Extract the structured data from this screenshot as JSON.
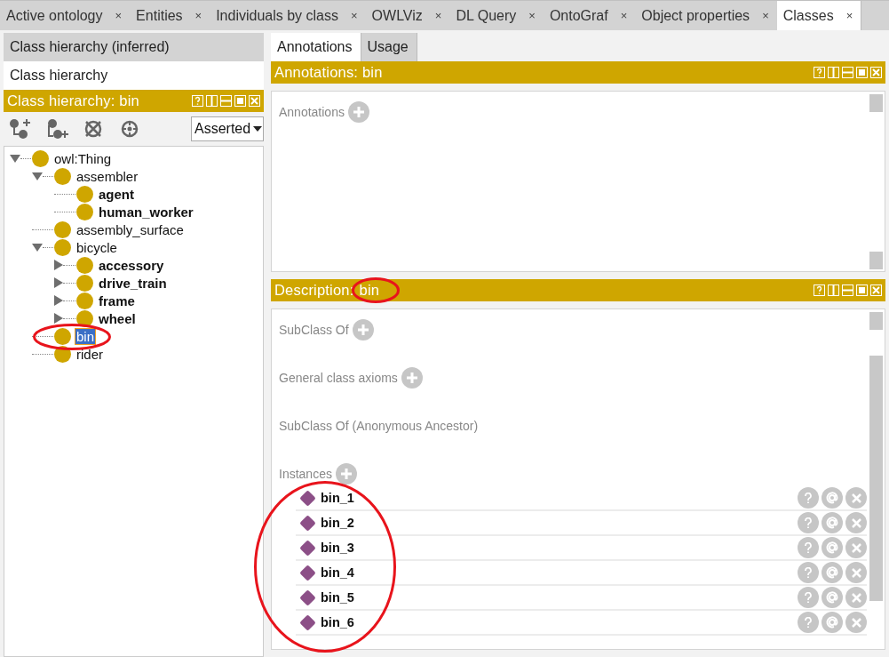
{
  "tabs": [
    {
      "label": "Active ontology",
      "close": "×",
      "selected": false
    },
    {
      "label": "Entities",
      "close": "×",
      "selected": false
    },
    {
      "label": "Individuals by class",
      "close": "×",
      "selected": false
    },
    {
      "label": "OWLViz",
      "close": "×",
      "selected": false
    },
    {
      "label": "DL Query",
      "close": "×",
      "selected": false
    },
    {
      "label": "OntoGraf",
      "close": "×",
      "selected": false
    },
    {
      "label": "Object properties",
      "close": "×",
      "selected": false
    },
    {
      "label": "Classes",
      "close": "×",
      "selected": true
    }
  ],
  "left_panel": {
    "view_tabs": [
      {
        "label": "Class hierarchy (inferred)",
        "selected": false
      },
      {
        "label": "Class hierarchy",
        "selected": true
      }
    ],
    "header": "Class hierarchy: bin",
    "mode_select": "Asserted",
    "tree": [
      {
        "label": "owl:Thing",
        "bold": false,
        "selected": false,
        "expanded": true,
        "children": [
          {
            "label": "assembler",
            "bold": false,
            "selected": false,
            "expanded": true,
            "children": [
              {
                "label": "agent",
                "bold": true,
                "selected": false
              },
              {
                "label": "human_worker",
                "bold": true,
                "selected": false
              }
            ]
          },
          {
            "label": "assembly_surface",
            "bold": false,
            "selected": false
          },
          {
            "label": "bicycle",
            "bold": false,
            "selected": false,
            "expanded": true,
            "children": [
              {
                "label": "accessory",
                "bold": true,
                "selected": false,
                "expanded": false
              },
              {
                "label": "drive_train",
                "bold": true,
                "selected": false,
                "expanded": false
              },
              {
                "label": "frame",
                "bold": true,
                "selected": false,
                "expanded": false
              },
              {
                "label": "wheel",
                "bold": true,
                "selected": false,
                "expanded": false
              }
            ]
          },
          {
            "label": "bin",
            "bold": false,
            "selected": true
          },
          {
            "label": "rider",
            "bold": false,
            "selected": false
          }
        ]
      }
    ]
  },
  "right_panel": {
    "tabs": [
      {
        "label": "Annotations",
        "selected": true
      },
      {
        "label": "Usage",
        "selected": false
      }
    ],
    "annotations_header": "Annotations: bin",
    "annotations_section": {
      "label": "Annotations",
      "addable": true
    },
    "description_header": {
      "title": "Description:",
      "entity": "bin"
    },
    "sections": [
      {
        "label": "SubClass Of",
        "addable": true
      },
      {
        "label": "General class axioms",
        "addable": true
      },
      {
        "label": "SubClass Of (Anonymous Ancestor)",
        "addable": false
      },
      {
        "label": "Instances",
        "addable": true
      }
    ],
    "instances": [
      {
        "name": "bin_1"
      },
      {
        "name": "bin_2"
      },
      {
        "name": "bin_3"
      },
      {
        "name": "bin_4"
      },
      {
        "name": "bin_5"
      },
      {
        "name": "bin_6"
      }
    ]
  }
}
